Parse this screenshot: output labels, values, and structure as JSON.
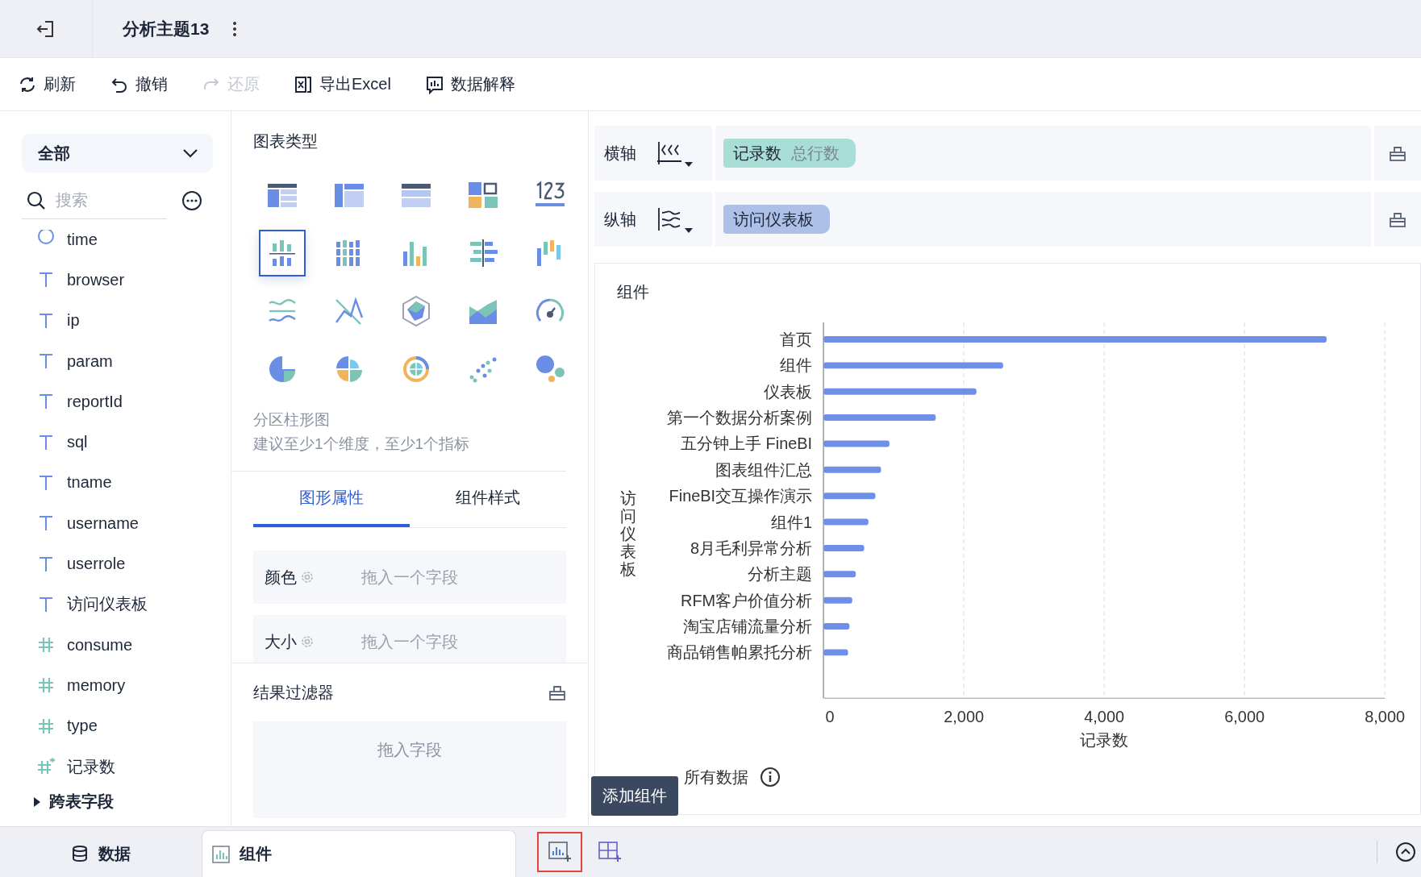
{
  "top_bar": {
    "title": "分析主题13"
  },
  "toolbar": [
    {
      "kind": "refresh",
      "label": "刷新",
      "disabled": false
    },
    {
      "kind": "undo",
      "label": "撤销",
      "disabled": false
    },
    {
      "kind": "redo",
      "label": "还原",
      "disabled": true
    },
    {
      "kind": "excel",
      "label": "导出Excel",
      "disabled": false
    },
    {
      "kind": "explain",
      "label": "数据解释",
      "disabled": false
    }
  ],
  "data_panel": {
    "scope": "全部",
    "search": {
      "placeholder": "搜索"
    },
    "fields": [
      {
        "kind": "date",
        "name": "time"
      },
      {
        "kind": "text",
        "name": "browser"
      },
      {
        "kind": "text",
        "name": "ip"
      },
      {
        "kind": "text",
        "name": "param"
      },
      {
        "kind": "text",
        "name": "reportId"
      },
      {
        "kind": "text",
        "name": "sql"
      },
      {
        "kind": "text",
        "name": "tname"
      },
      {
        "kind": "text",
        "name": "username"
      },
      {
        "kind": "text",
        "name": "userrole"
      },
      {
        "kind": "text",
        "name": "访问仪表板"
      },
      {
        "kind": "number",
        "name": "consume"
      },
      {
        "kind": "number",
        "name": "memory"
      },
      {
        "kind": "number",
        "name": "type"
      },
      {
        "kind": "calc",
        "name": "记录数"
      }
    ],
    "group": {
      "label": "跨表字段",
      "expanded": false
    }
  },
  "chart_panel": {
    "title": "图表类型",
    "chart_types": [
      {
        "kind": "table",
        "selected": false
      },
      {
        "kind": "cross-table",
        "selected": false
      },
      {
        "kind": "detail-table",
        "selected": false
      },
      {
        "kind": "tiles",
        "selected": false
      },
      {
        "kind": "number",
        "selected": false
      },
      {
        "kind": "partition-bar",
        "selected": true
      },
      {
        "kind": "stacked-bar",
        "selected": false
      },
      {
        "kind": "multi-bar",
        "selected": false
      },
      {
        "kind": "compare-bar",
        "selected": false
      },
      {
        "kind": "range-bar",
        "selected": false
      },
      {
        "kind": "wave",
        "selected": false
      },
      {
        "kind": "line",
        "selected": false
      },
      {
        "kind": "radar",
        "selected": false
      },
      {
        "kind": "area",
        "selected": false
      },
      {
        "kind": "gauge",
        "selected": false
      },
      {
        "kind": "pie",
        "selected": false
      },
      {
        "kind": "rose",
        "selected": false
      },
      {
        "kind": "sunburst",
        "selected": false
      },
      {
        "kind": "scatter",
        "selected": false
      },
      {
        "kind": "bubble",
        "selected": false
      }
    ],
    "selected_name": "分区柱形图",
    "hint": "建议至少1个维度，至少1个指标",
    "tabs": [
      {
        "label": "图形属性",
        "selected": true
      },
      {
        "label": "组件样式",
        "selected": false
      }
    ],
    "properties": [
      {
        "label": "颜色",
        "placeholder": "拖入一个字段"
      },
      {
        "label": "大小",
        "placeholder": "拖入一个字段"
      }
    ],
    "filter": {
      "title": "结果过滤器",
      "placeholder": "拖入字段"
    }
  },
  "axes": [
    {
      "label": "横轴",
      "kind": "x",
      "pills": [
        {
          "kind": "measure",
          "text": "记录数",
          "note": "总行数"
        }
      ]
    },
    {
      "label": "纵轴",
      "kind": "y",
      "pills": [
        {
          "kind": "dimension",
          "text": "访问仪表板"
        }
      ]
    }
  ],
  "widget": {
    "title": "组件",
    "chart_data": {
      "type": "bar",
      "orientation": "horizontal",
      "xlabel": "记录数",
      "ylabel": "访问仪表板",
      "categories": [
        "首页",
        "组件",
        "仪表板",
        "第一个数据分析案例",
        "五分钟上手 FineBI",
        "图表组件汇总",
        "FineBI交互操作演示",
        "组件1",
        "8月毛利异常分析",
        "分析主题",
        "RFM客户价值分析",
        "淘宝店铺流量分析",
        "商品销售帕累托分析"
      ],
      "values": [
        7170,
        2560,
        2180,
        1600,
        940,
        820,
        740,
        640,
        580,
        460,
        410,
        370,
        350
      ],
      "grid": true,
      "xlim": [
        0,
        8000
      ],
      "xticks": [
        {
          "value": 0,
          "label": "0"
        },
        {
          "value": 2000,
          "label": "2,000"
        },
        {
          "value": 4000,
          "label": "4,000"
        },
        {
          "value": 6000,
          "label": "6,000"
        },
        {
          "value": 8000,
          "label": "8,000"
        }
      ]
    },
    "footer": "所有数据",
    "tooltip": "添加组件"
  },
  "bottom_bar": {
    "tabs": [
      {
        "kind": "data",
        "label": "数据",
        "selected": false
      },
      {
        "kind": "widget",
        "label": "组件",
        "selected": true
      }
    ],
    "actions": [
      {
        "kind": "add-chart",
        "highlighted": true
      },
      {
        "kind": "add-table",
        "highlighted": false
      }
    ]
  }
}
